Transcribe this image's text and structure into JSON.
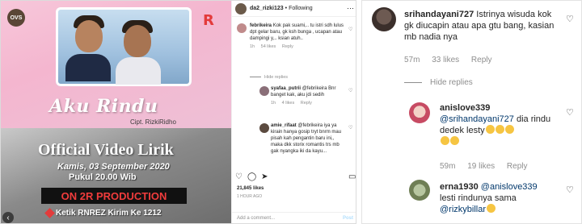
{
  "post": {
    "image": {
      "logo_left": "OVS",
      "logo_right": "R",
      "song_title": "Aku Rindu",
      "credit": "Cipt. RizkiRidho",
      "headline": "Official Video Lirik",
      "date": "Kamis, 03 September 2020",
      "time": "Pukul 20.00 Wib",
      "production": "ON 2R PRODUCTION",
      "sms": "Ketik RNREZ Kirim Ke 1212"
    },
    "header": {
      "username": "da2_rizki123",
      "follow": "Following",
      "more_icon": "ellipsis-icon"
    },
    "comments": [
      {
        "username": "febrikeira",
        "text": "Kok pak suami,.. tu istri sdh lulus dpt gelar baru, gk ksh bunga , ucapan atau dampingi y,.. ksian atuh..",
        "time": "1h",
        "likes": "54 likes",
        "reply": "Reply"
      },
      {
        "username": "syafaa_putrii",
        "text": "@febrikeira Bnr banget kak, aku jdi sedih",
        "time": "1h",
        "likes": "4 likes",
        "reply": "Reply"
      },
      {
        "username": "amie_rifaat",
        "text": "@febrikeira iya ya kirain hanya gosip tryt bnrm mau pisah kah pengantin baru ini,, maka dkk storix romantis trs mb gak nyangka iki da kayu...",
        "time": "1h",
        "likes": "",
        "reply": "Reply"
      }
    ],
    "likes": "21,845 likes",
    "ago": "1 HOUR AGO",
    "add_placeholder": "Add a comment...",
    "post_label": "Post"
  },
  "panel": {
    "comments": [
      {
        "username": "srihandayani727",
        "text": "Istrinya wisuda kok gk diucapin atau apa gtu bang, kasian mb nadia nya",
        "time": "57m",
        "likes": "33 likes",
        "reply": "Reply"
      },
      {
        "username": "anislove339",
        "mention": "@srihandayani727",
        "text": "dia rindu dedek lesty",
        "time": "59m",
        "likes": "19 likes",
        "reply": "Reply"
      },
      {
        "username": "erna1930",
        "mention": "@anislove339",
        "text": "lesti rindunya sama",
        "mention2": "@rizkybillar"
      }
    ],
    "hide_replies": "Hide replies"
  },
  "colors": {
    "link": "#00376b",
    "muted": "#8e8e8e",
    "text": "#262626",
    "production_red": "#f03c3c"
  }
}
